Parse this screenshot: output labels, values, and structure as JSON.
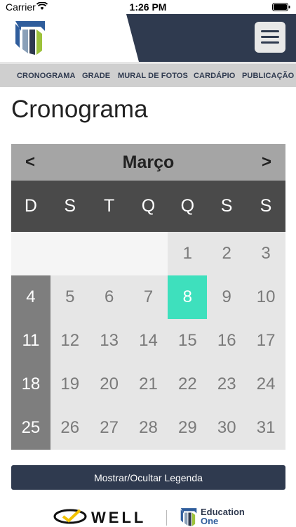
{
  "status_bar": {
    "carrier": "Carrier",
    "time": "1:26 PM"
  },
  "header": {
    "menu_icon": "hamburger-icon",
    "logo_icon": "school-logo-icon"
  },
  "nav": {
    "items": [
      "CRONOGRAMA",
      "GRADE",
      "MURAL DE FOTOS",
      "CARDÁPIO",
      "PUBLICAÇÃO"
    ]
  },
  "page": {
    "title": "Cronograma"
  },
  "calendar": {
    "prev": "<",
    "next": ">",
    "month": "Março",
    "weekdays": [
      "D",
      "S",
      "T",
      "Q",
      "Q",
      "S",
      "S"
    ],
    "weeks": [
      [
        "",
        "",
        "",
        "",
        "1",
        "2",
        "3"
      ],
      [
        "4",
        "5",
        "6",
        "7",
        "8",
        "9",
        "10"
      ],
      [
        "11",
        "12",
        "13",
        "14",
        "15",
        "16",
        "17"
      ],
      [
        "18",
        "19",
        "20",
        "21",
        "22",
        "23",
        "24"
      ],
      [
        "25",
        "26",
        "27",
        "28",
        "29",
        "30",
        "31"
      ]
    ],
    "highlighted_day": "8"
  },
  "legend_button": {
    "label": "Mostrar/Ocultar Legenda"
  },
  "footer": {
    "well_text": "WELL",
    "edu_line1": "Education",
    "edu_line2": "One"
  },
  "colors": {
    "primary": "#2f3a4f",
    "highlight": "#3ee0bd",
    "sunday": "#7e7e7e",
    "cell": "#e6e6e6"
  }
}
